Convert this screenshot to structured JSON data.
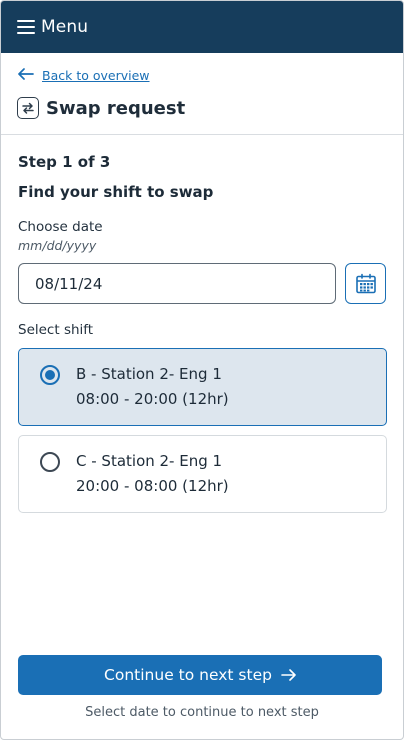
{
  "header": {
    "menu_label": "Menu",
    "menu_icon": "hamburger-icon"
  },
  "nav": {
    "back_label": "Back to overview",
    "back_icon": "arrow-left-icon"
  },
  "page": {
    "title": "Swap request",
    "title_icon": "swap-icon"
  },
  "step": {
    "label": "Step 1 of 3",
    "heading": "Find your shift to swap"
  },
  "date": {
    "label": "Choose date",
    "hint": "mm/dd/yyyy",
    "value": "08/11/24",
    "calendar_icon": "calendar-icon"
  },
  "shift": {
    "label": "Select shift",
    "options": [
      {
        "title": "B - Station 2- Eng 1",
        "time": "08:00 - 20:00 (12hr)",
        "selected": true
      },
      {
        "title": "C - Station 2- Eng 1",
        "time": "20:00 - 08:00 (12hr)",
        "selected": false
      }
    ]
  },
  "actions": {
    "continue_label": "Continue to next step",
    "continue_icon": "arrow-right-icon",
    "helper_text": "Select date to continue to  next step"
  },
  "colors": {
    "header_bg": "#163d5c",
    "accent": "#1a6fb5",
    "selected_bg": "#dde6ee"
  }
}
